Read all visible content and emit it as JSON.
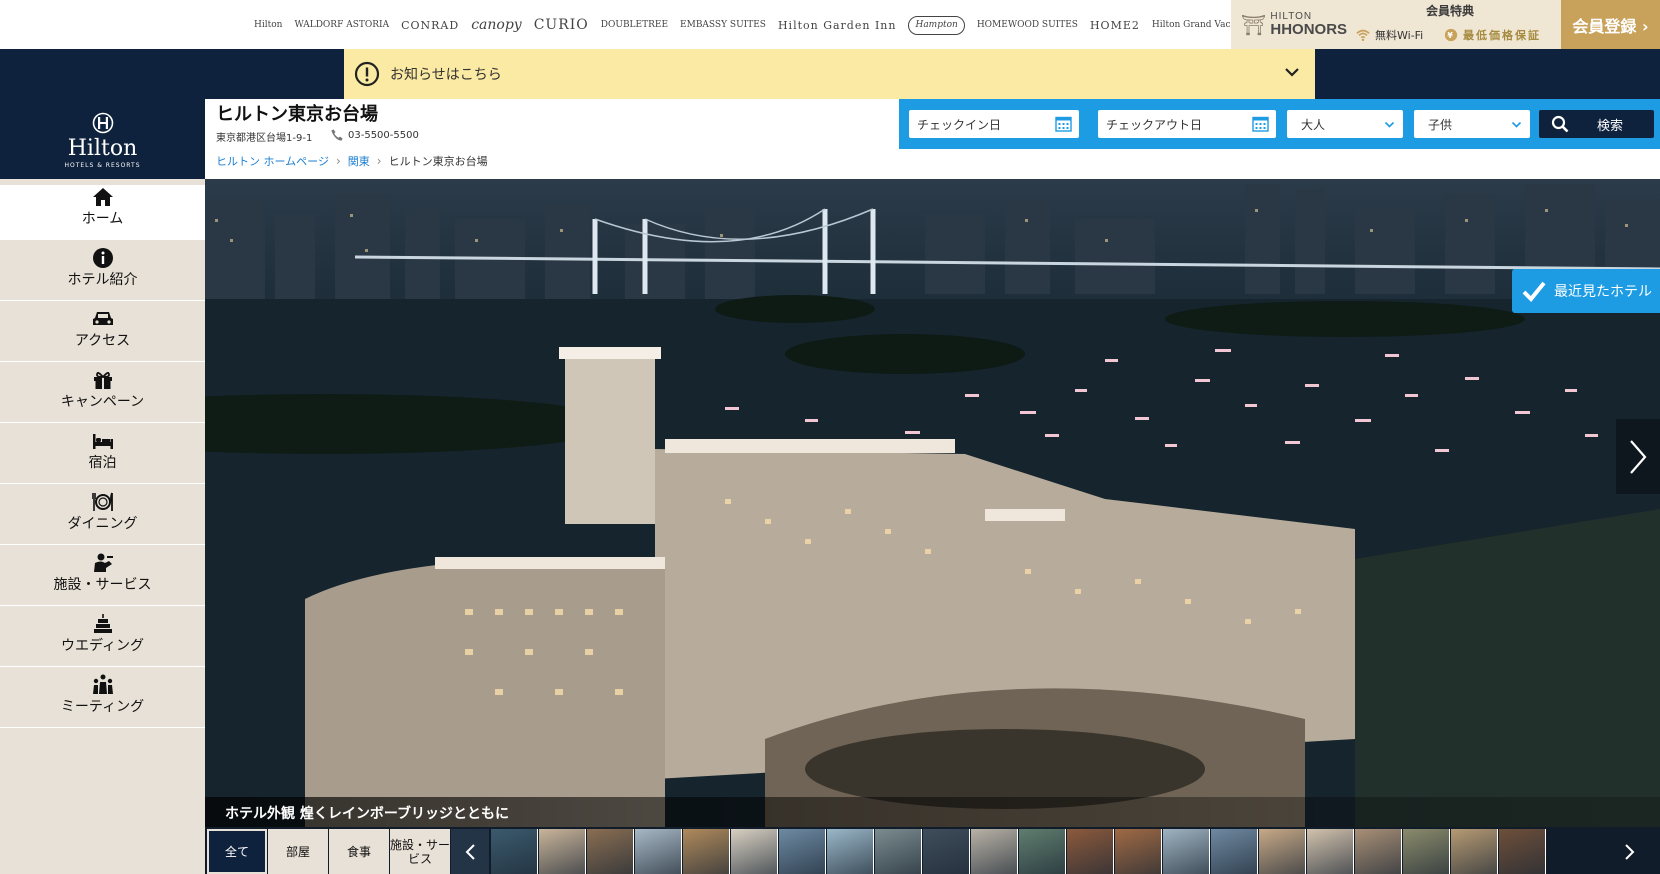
{
  "brands": [
    {
      "name": "Hilton",
      "style": "b-sm"
    },
    {
      "name": "WALDORF ASTORIA",
      "style": "b-sm"
    },
    {
      "name": "CONRAD",
      "style": "b-md"
    },
    {
      "name": "canopy",
      "style": "b-lg"
    },
    {
      "name": "CURIO",
      "style": "b-cu"
    },
    {
      "name": "DOUBLETREE",
      "style": "b-sm"
    },
    {
      "name": "EMBASSY SUITES",
      "style": "b-sm"
    },
    {
      "name": "Hilton Garden Inn",
      "style": "b-md"
    },
    {
      "name": "Hampton",
      "style": "b-hm"
    },
    {
      "name": "HOMEWOOD SUITES",
      "style": "b-sm"
    },
    {
      "name": "HOME2",
      "style": "b-md"
    },
    {
      "name": "Hilton Grand Vacations",
      "style": "b-sm"
    }
  ],
  "honors": {
    "logo_top": "HILTON",
    "logo_bottom": "HHONORS",
    "perks_title": "会員特典",
    "wifi": "無料Wi-Fi",
    "price": "最低価格保証",
    "join_label": "会員登録 ›"
  },
  "notice": {
    "text": "お知らせはこちら"
  },
  "logo": {
    "name": "Hilton",
    "sub": "HOTELS & RESORTS"
  },
  "nav": [
    {
      "label": "ホーム",
      "icon": "home-icon",
      "active": true
    },
    {
      "label": "ホテル紹介",
      "icon": "info-icon"
    },
    {
      "label": "アクセス",
      "icon": "car-icon"
    },
    {
      "label": "キャンペーン",
      "icon": "gift-icon"
    },
    {
      "label": "宿泊",
      "icon": "bed-icon"
    },
    {
      "label": "ダイニング",
      "icon": "dining-icon"
    },
    {
      "label": "施設・サービス",
      "icon": "concierge-icon"
    },
    {
      "label": "ウエディング",
      "icon": "cake-icon"
    },
    {
      "label": "ミーティング",
      "icon": "meeting-icon"
    }
  ],
  "hotel": {
    "name": "ヒルトン東京お台場",
    "address": "東京都港区台場1-9-1",
    "tel": "03-5500-5500"
  },
  "breadcrumb": [
    "ヒルトン ホームページ",
    "関東",
    "ヒルトン東京お台場"
  ],
  "search": {
    "checkin": "チェックイン日",
    "checkout": "チェックアウト日",
    "adults": "大人",
    "children": "子供",
    "button": "検索"
  },
  "hero": {
    "recent_label": "最近見たホテル",
    "caption": "ホテル外観 煌くレインボーブリッジとともに"
  },
  "gallery": {
    "tabs": [
      "全て",
      "部屋",
      "食事",
      "施設・サービス"
    ],
    "active_tab": 0
  },
  "colors": {
    "navy": "#0f223d",
    "accent_blue": "#1d9ce3",
    "gold": "#c8a15a",
    "notice_yellow": "#fbeaa3",
    "sidebar_beige": "#e8e1d7"
  }
}
